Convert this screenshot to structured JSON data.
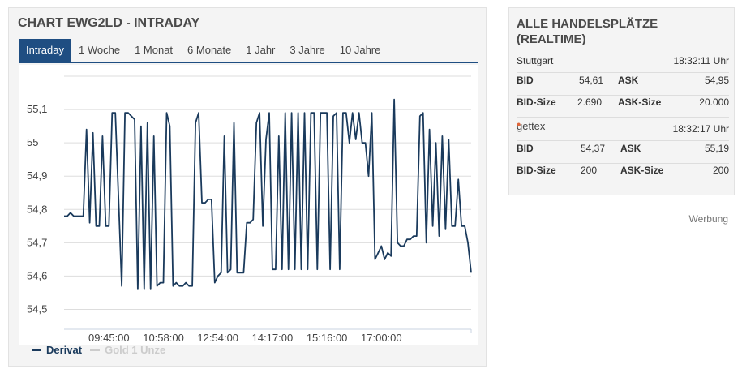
{
  "chart_panel": {
    "title": "CHART EWG2LD - INTRADAY",
    "tabs": [
      "Intraday",
      "1 Woche",
      "1 Monat",
      "6 Monate",
      "1 Jahr",
      "3 Jahre",
      "10 Jahre"
    ],
    "active_tab": "Intraday"
  },
  "legend": {
    "derivat": "Derivat",
    "gold": "Gold 1 Unze"
  },
  "colors": {
    "line": "#1a3a5c",
    "tab_active": "#1f4e82",
    "legend_inactive": "#cccccc",
    "grid": "#dddddd"
  },
  "chart_data": {
    "type": "line",
    "title": "CHART EWG2LD - INTRADAY",
    "xlabel": "",
    "ylabel": "",
    "ylim": [
      54.45,
      55.2
    ],
    "y_ticks": [
      "54,5",
      "54,6",
      "54,7",
      "54,8",
      "54,9",
      "55",
      "55,1"
    ],
    "y_tick_values": [
      54.5,
      54.6,
      54.7,
      54.8,
      54.9,
      55.0,
      55.1
    ],
    "x_tick_labels": [
      "09:45:00",
      "10:58:00",
      "12:54:00",
      "14:17:00",
      "15:16:00",
      "17:00:00"
    ],
    "x_tick_index": [
      14,
      31,
      48,
      65,
      82,
      99
    ],
    "grid": true,
    "legend_position": "bottom-left",
    "series": [
      {
        "name": "Derivat",
        "values": [
          54.78,
          54.78,
          54.79,
          54.78,
          54.78,
          54.78,
          54.78,
          55.04,
          54.76,
          55.03,
          54.75,
          54.75,
          55.02,
          54.75,
          54.75,
          55.09,
          55.09,
          54.83,
          54.57,
          55.09,
          55.09,
          55.08,
          55.07,
          54.56,
          55.05,
          54.56,
          55.06,
          54.56,
          55.02,
          54.57,
          54.58,
          54.58,
          55.09,
          55.05,
          54.57,
          54.58,
          54.57,
          54.57,
          54.58,
          54.57,
          54.57,
          55.06,
          55.09,
          54.82,
          54.82,
          54.83,
          54.83,
          54.58,
          54.6,
          54.61,
          55.02,
          54.61,
          54.62,
          55.06,
          54.61,
          54.61,
          54.61,
          54.76,
          54.76,
          54.77,
          55.06,
          55.09,
          54.75,
          55.01,
          55.09,
          54.62,
          54.62,
          55.02,
          54.62,
          55.09,
          54.62,
          55.09,
          54.62,
          55.09,
          54.62,
          55.09,
          54.62,
          55.09,
          55.09,
          54.62,
          55.09,
          55.09,
          55.09,
          54.62,
          55.08,
          55.09,
          54.62,
          55.09,
          55.09,
          55.0,
          55.09,
          55.01,
          55.09,
          55.0,
          55.0,
          54.9,
          55.09,
          54.65,
          54.67,
          54.69,
          54.65,
          54.67,
          54.66,
          55.13,
          54.7,
          54.69,
          54.69,
          54.71,
          54.71,
          54.72,
          54.72,
          55.08,
          55.09,
          54.7,
          55.04,
          54.75,
          55.0,
          54.72,
          55.02,
          54.74,
          55.01,
          54.75,
          54.75,
          54.89,
          54.75,
          54.75,
          54.7,
          54.61
        ]
      }
    ]
  },
  "quote_panel": {
    "title": "ALLE HANDELSPLÄTZE (REALTIME)",
    "stuttgart": {
      "exchange": "Stuttgart",
      "time": "18:32:11 Uhr",
      "bid_label": "BID",
      "bid": "54,61",
      "ask_label": "ASK",
      "ask": "54,95",
      "bid_size_label": "BID-Size",
      "bid_size": "2.690",
      "ask_size_label": "ASK-Size",
      "ask_size": "20.000"
    },
    "gettex": {
      "exchange": "gettex",
      "time": "18:32:17 Uhr",
      "bid_label": "BID",
      "bid": "54,37",
      "ask_label": "ASK",
      "ask": "55,19",
      "bid_size_label": "BID-Size",
      "bid_size": "200",
      "ask_size_label": "ASK-Size",
      "ask_size": "200"
    }
  },
  "werbung": "Werbung"
}
